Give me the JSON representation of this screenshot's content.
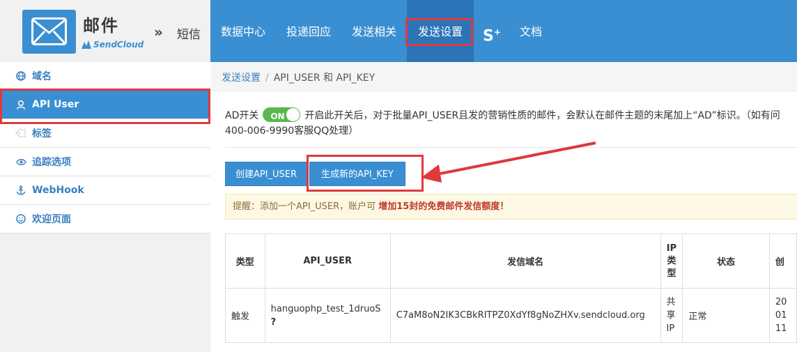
{
  "brand": {
    "title": "邮件",
    "sub": "SendCloud",
    "arrow": "»",
    "sms": "短信"
  },
  "topnav": [
    {
      "label": "数据中心"
    },
    {
      "label": "投递回应"
    },
    {
      "label": "发送相关"
    },
    {
      "label": "发送设置"
    },
    {
      "label": "S"
    },
    {
      "label": "文档"
    }
  ],
  "sidebar": [
    {
      "label": "域名",
      "icon": "globe-icon"
    },
    {
      "label": "API User",
      "icon": "user-icon"
    },
    {
      "label": "标签",
      "icon": "tag-icon"
    },
    {
      "label": "追踪选项",
      "icon": "eye-icon"
    },
    {
      "label": "WebHook",
      "icon": "anchor-icon"
    },
    {
      "label": "欢迎页面",
      "icon": "smile-icon"
    }
  ],
  "breadcrumb": {
    "parent": "发送设置",
    "separator": "/",
    "current": "API_USER 和 API_KEY"
  },
  "ad": {
    "label": "AD开关",
    "toggle": "ON",
    "text": "开启此开关后，对于批量API_USER且发的营销性质的邮件，会默认在邮件主题的末尾加上“AD”标识。（如有问",
    "text2": "400-006-9990客服QQ处理）"
  },
  "buttons": {
    "create": "创建API_USER",
    "generate": "生成新的API_KEY"
  },
  "notice": {
    "prefix": "提醒：",
    "text": "添加一个API_USER，账户可",
    "strong": "增加15封的免费邮件发信额度！"
  },
  "table": {
    "headers": [
      "类型",
      "API_USER",
      "发信域名",
      "IP类型",
      "状态",
      "创"
    ],
    "row": {
      "type": "触发",
      "api_user": "hanguophp_test_1druoS",
      "api_user_tail": "?",
      "domain": "C7aM8oN2IK3CBkRITPZ0XdYf8gNoZHXv.sendcloud.org",
      "ip_type": "共享IP",
      "status": "正常",
      "created_partial": "20\n01\n11"
    }
  },
  "colors": {
    "primary": "#3a8fd2",
    "highlight": "#e0383c",
    "toggle_on": "#58b84c"
  }
}
